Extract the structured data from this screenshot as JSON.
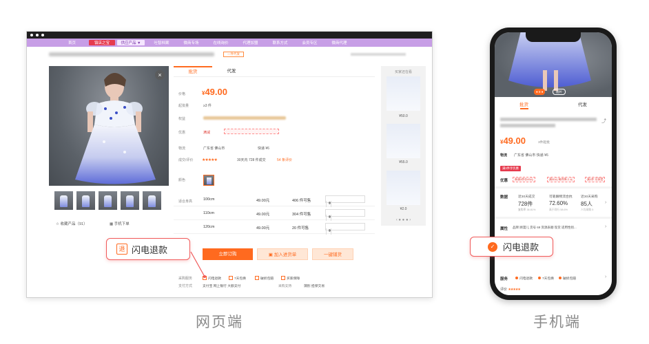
{
  "desktop": {
    "nav": [
      "首页",
      "镇店之宝",
      "供应产品 ▼",
      "吐智档案",
      "微商专场",
      "在线询价",
      "代理加盟",
      "联系方式",
      "会员专区",
      "微商代理"
    ],
    "title_tag": "一件代发",
    "tabs": [
      "批货",
      "代发"
    ],
    "price_label": "价格",
    "price_currency": "¥",
    "price": "49.00",
    "moq_label": "起批量",
    "moq": "≥3 件",
    "guarantee_label": "权益",
    "coupon_label": "优惠",
    "coupon_text": "满减",
    "shipping_label": "物流",
    "shipping_from": "广东省 佛山市",
    "shipping_fee": "快递 ¥6",
    "rating_label": "成交/评价",
    "rating_stars": "★★★★★",
    "sales_text": "30天内 728 件成交",
    "reviews_text": "54 条评价",
    "color_label": "颜色",
    "size_label": "适合身高",
    "sizes": [
      {
        "name": "100cm",
        "price": "49.00元",
        "stock": "406 件可售",
        "qty": "0"
      },
      {
        "name": "110cm",
        "price": "49.00元",
        "stock": "304 件可售",
        "qty": "0"
      },
      {
        "name": "120cm",
        "price": "49.00元",
        "stock": "20 件可售",
        "qty": "0"
      }
    ],
    "stepper_minus": "−",
    "stepper_plus": "+",
    "buy_button": "立即订购",
    "cart_button": "加入进货单",
    "oneclick_button": "一键铺货",
    "fav": "☆ 收藏产品（91）",
    "phone_order": "手机下单",
    "service_label": "采购服务",
    "services": [
      "闪电退款",
      "7天包换",
      "破损包赔",
      "买家保障"
    ],
    "pay_label": "支付方式",
    "pay_methods": "支付宝   网上银行   大额支付",
    "pay_label2": "采购支持",
    "pay_support": "蒲别   担保交易",
    "side_title": "买家还在看",
    "side_prices": [
      "¥50.0",
      "¥55.0",
      "¥2.0"
    ],
    "side_pager": "‹ ● ● ● ›",
    "close_glyph": "×"
  },
  "callout_web": {
    "badge": "退",
    "text": "闪电退款"
  },
  "callout_mobile": {
    "badge": "✓",
    "text": "闪电退款"
  },
  "labels": {
    "web": "网页端",
    "mobile": "手机端"
  },
  "mobile": {
    "tabs": [
      "批货",
      "代发"
    ],
    "price_currency": "¥",
    "price": "49.00",
    "moq": "3件起批",
    "shipping_label": "物流",
    "shipping_text": "广东省 佛山市    快递 ¥6",
    "badge": "满3件享优惠",
    "coupon_label": "优惠",
    "coupons": [
      "券满3件价49元",
      "满30元 每件降 2 元",
      "满1件 可享受"
    ],
    "data_label": "数据",
    "stats": [
      {
        "title": "近30天成交",
        "value": "728件",
        "sub": "复购率 38.81%"
      },
      {
        "title": "可靠跟物流合抗",
        "value": "72.60%",
        "sub": "高于同行 58.6%"
      },
      {
        "title": "近30天采购",
        "value": "85人",
        "sub": "人均采购 5"
      }
    ],
    "attr_label": "属性",
    "attr_text": "品牌 顾漫儿  货号 69 资源表顺 现货  适用性别...",
    "service_label": "服务",
    "services": [
      "闪电退款",
      "7天包换",
      "破损包赔"
    ],
    "bottom_text": "评价",
    "bottom_stars": "★★★★★",
    "hero_badge": "● 8 ●",
    "hero_badge2": "图片",
    "chevron": "›"
  },
  "colors": {
    "accent": "#ff6a1f",
    "nav": "#c79ee6",
    "callout_border": "#f05a5a",
    "red": "#e63b4e"
  }
}
